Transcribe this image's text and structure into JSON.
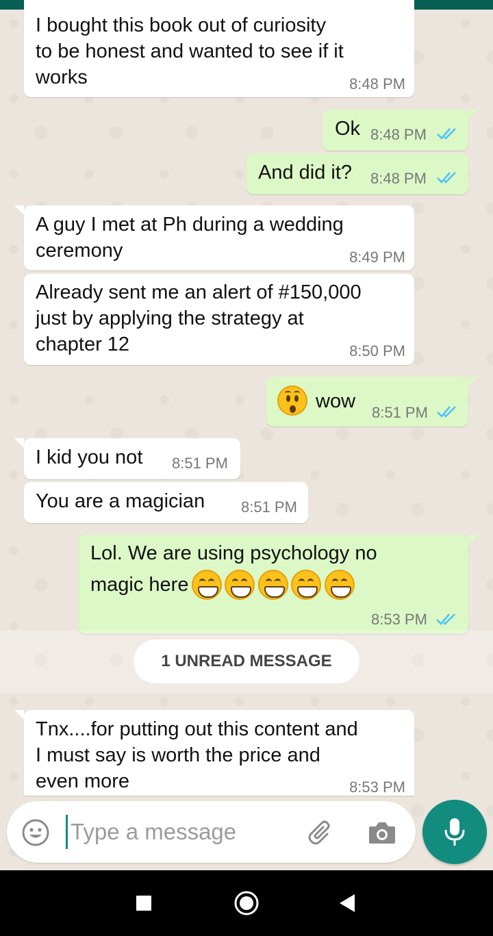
{
  "messages": [
    {
      "text": "I bought this book out of curiosity\nto be honest and wanted to see if it\nworks",
      "time": "8:48 PM"
    },
    {
      "text": "Ok",
      "time": "8:48 PM"
    },
    {
      "text": "And did it?",
      "time": "8:48 PM"
    },
    {
      "text": "A guy I met at Ph during a wedding\nceremony",
      "time": "8:49 PM"
    },
    {
      "text": "Already sent me an alert of #150,000\njust by applying the strategy at\nchapter 12",
      "time": "8:50 PM"
    },
    {
      "text": "wow",
      "time": "8:51 PM"
    },
    {
      "text": "I kid you not",
      "time": "8:51 PM"
    },
    {
      "text": "You are a magician",
      "time": "8:51 PM"
    },
    {
      "text": "Lol. We are using psychology no",
      "text2": "magic here",
      "time": "8:53 PM"
    },
    {
      "text": "Tnx....for putting out this content and\nI must say is worth the price and\neven more",
      "time": "8:53 PM"
    }
  ],
  "unread_banner": "1 UNREAD MESSAGE",
  "input": {
    "placeholder": "Type a message"
  },
  "icons": {
    "emoji": "emoji-icon",
    "attach": "paperclip-icon",
    "camera": "camera-icon",
    "mic": "microphone-icon",
    "read": "double-check-icon",
    "nav_recent": "square-icon",
    "nav_home": "circle-icon",
    "nav_back": "triangle-back-icon"
  },
  "colors": {
    "header": "#075e54",
    "incoming": "#ffffff",
    "outgoing": "#dcf8c6",
    "read_ticks": "#4fc3f7",
    "accent": "#128c7e"
  }
}
